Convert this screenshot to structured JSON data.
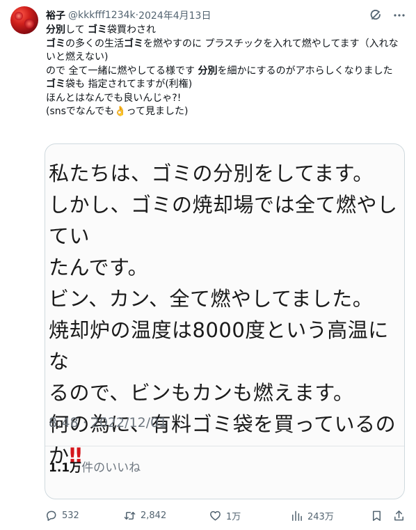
{
  "author": {
    "display_name": "裕子",
    "handle": "@kkkfff1234k",
    "separator": "·",
    "date": "2024年4月13日"
  },
  "icons": {
    "avatar": "rose-avatar",
    "grok": "grok-icon",
    "more": "more-icon",
    "reply": "reply-icon",
    "retweet": "retweet-icon",
    "like": "heart-icon",
    "views": "views-icon",
    "bookmark": "bookmark-icon",
    "share": "share-icon"
  },
  "tweet": {
    "line1": {
      "a": "分別",
      "b": "して ",
      "c": "ゴミ",
      "d": "袋買わされ"
    },
    "line2": {
      "a": "ゴミ",
      "b": "の多くの生活",
      "c": "ゴミ",
      "d": "を燃やすのに プラスチックを入れて燃やしてます（入れないと燃えない)"
    },
    "line3": {
      "a": "ので 全て一緒に燃やしてる様です ",
      "b": "分別",
      "c": "を細かにするのがアホらしくなりました"
    },
    "line4": {
      "a": "ゴミ",
      "b": "袋も 指定されてますが(利権)"
    },
    "line5": "ほんとはなんでも良いんじゃ?!",
    "line6": {
      "a": "(snsでなんでも",
      "emoji": "👌",
      "b": "って見ました)"
    }
  },
  "quoted_image": {
    "lines": [
      "私たちは、ゴミの分別をしてます。",
      "しかし、ゴミの焼却場では全て燃やしてい",
      "たんです。",
      "ビン、カン、全て燃やしてました。",
      "焼却炉の温度は8000度という高温にな",
      "るので、ビンもカンも燃えます。",
      "何の為に、有料ゴミ袋を買っているの",
      "か"
    ],
    "exclaim": "‼",
    "timestamp": "8:48 · 2022/12/01",
    "likes_count": "1.1万",
    "likes_label": "件のいいね"
  },
  "actions": {
    "replies": "532",
    "retweets": "2,842",
    "likes": "1万",
    "views": "243万"
  },
  "colors": {
    "text": "#0f1419",
    "secondary": "#536471",
    "border": "#cfd9de",
    "exclaim": "#d4161c"
  }
}
